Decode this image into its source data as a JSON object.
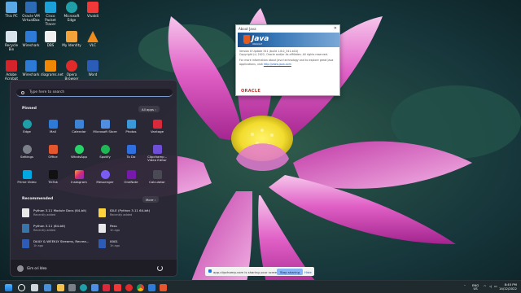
{
  "desktop": {
    "icons": [
      {
        "label": "This PC",
        "color": "#5aa9e6"
      },
      {
        "label": "Oracle VM VirtualBox",
        "color": "#2d6cb5"
      },
      {
        "label": "Cisco Packet Tracer",
        "color": "#1ba0d7"
      },
      {
        "label": "Microsoft Edge",
        "color": "#1fa0a8"
      },
      {
        "label": "Vivaldi",
        "color": "#ef3939"
      },
      {
        "label": "Recycle Bin",
        "color": "#d9e3ec"
      },
      {
        "label": "Wireshark",
        "color": "#2d7bd6"
      },
      {
        "label": "DBS",
        "color": "#f0f0f0"
      },
      {
        "label": "My Identity",
        "color": "#f2a33a"
      },
      {
        "label": "VLC",
        "color": "#f08c1e"
      },
      {
        "label": "Adobe Acrobat",
        "color": "#d4232a"
      },
      {
        "label": "Wireshark",
        "color": "#2d7bd6"
      },
      {
        "label": "diagrams.net",
        "color": "#f08705"
      },
      {
        "label": "Opera Browser",
        "color": "#e22a2a"
      },
      {
        "label": "Word",
        "color": "#2b5cb8"
      }
    ]
  },
  "java_dialog": {
    "title": "About Java",
    "brand": "Java",
    "brand_sub": "ORACLE",
    "version_line": "Version 8 Update 341   (build 1.8.0_341-b10)",
    "copyright": "Copyright (c) 2022, Oracle and/or its affiliates. All rights reserved.",
    "info_line": "For more information about Java technology and to explore great Java",
    "info_line2": "applications, visit",
    "link": "http://www.java.com",
    "oracle_logo": "ORACLE"
  },
  "start_menu": {
    "search_placeholder": "Type here to search",
    "pinned_title": "Pinned",
    "all_apps_label": "All apps  ›",
    "pinned": [
      {
        "label": "Edge",
        "color": "#1fa0a8"
      },
      {
        "label": "Mail",
        "color": "#2d7bd6"
      },
      {
        "label": "Calendar",
        "color": "#3b84d8"
      },
      {
        "label": "Microsoft Store",
        "color": "#4f8ee0"
      },
      {
        "label": "Photos",
        "color": "#3a9ad9"
      },
      {
        "label": "Vantage",
        "color": "#d9293b"
      },
      {
        "label": "Settings",
        "color": "#7a7f88"
      },
      {
        "label": "Office",
        "color": "#e4572e"
      },
      {
        "label": "WhatsApp",
        "color": "#25d366"
      },
      {
        "label": "Spotify",
        "color": "#1db954"
      },
      {
        "label": "To Do",
        "color": "#2f6fe0"
      },
      {
        "label": "Clipchamp – Video Editor",
        "color": "#6f4fd8"
      },
      {
        "label": "Prime Video",
        "color": "#00a8e1"
      },
      {
        "label": "TikTok",
        "color": "#111111"
      },
      {
        "label": "Instagram",
        "color": "#d62976"
      },
      {
        "label": "Messenger",
        "color": "#7a5cf5"
      },
      {
        "label": "OneNote",
        "color": "#7719aa"
      },
      {
        "label": "Calculator",
        "color": "#4a4a55"
      }
    ],
    "recommended_title": "Recommended",
    "more_label": "More  ›",
    "recommended": [
      {
        "title": "Python 3.11 Module Docs (64-bit)",
        "sub": "Recently added"
      },
      {
        "title": "IDLE (Python 3.11 64-bit)",
        "sub": "Recently added"
      },
      {
        "title": "Python 3.11 (64-bit)",
        "sub": "Recently added"
      },
      {
        "title": "Pass",
        "sub": "1h ago"
      },
      {
        "title": "DAILY & WEEKLY Streams, Recrea...",
        "sub": "1h ago"
      },
      {
        "title": "0001",
        "sub": "1h ago"
      }
    ],
    "user_name": "Gim ori Idea"
  },
  "share_bar": {
    "text": "app.clipchamp.com is sharing your screen.",
    "stop_label": "Stop sharing",
    "hide_label": "Hide"
  },
  "taskbar": {
    "tray_lang_1": "ENG",
    "tray_lang_2": "US",
    "time": "8:45 PM",
    "date": "14/12/2022"
  }
}
